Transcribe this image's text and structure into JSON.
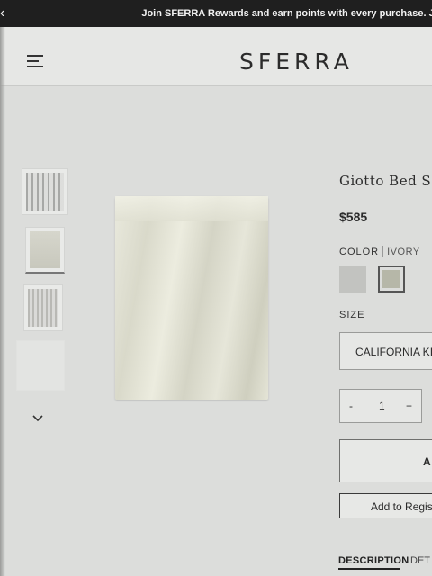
{
  "promo": {
    "back_icon": "chevron-left-icon",
    "message": "Join SFERRA Rewards and earn points with every purchase. J"
  },
  "header": {
    "menu_icon": "menu-icon",
    "logo": "SFERRA"
  },
  "gallery": {
    "thumbnails": 4,
    "more_icon": "chevron-down-icon"
  },
  "product": {
    "title": "Giotto Bed SI",
    "price": "$585",
    "color_label": "COLOR",
    "color_value": "IVORY",
    "swatches": [
      "#c2c3c0",
      "#b6b7a8"
    ],
    "size_label": "SIZE",
    "size_value": "CALIFORNIA KIN",
    "quantity": {
      "minus": "-",
      "value": "1",
      "plus": "+"
    },
    "add_to_cart": "A",
    "add_to_registry": "Add to Regis"
  },
  "tabs": {
    "description": "DESCRIPTION",
    "details": "DET"
  }
}
